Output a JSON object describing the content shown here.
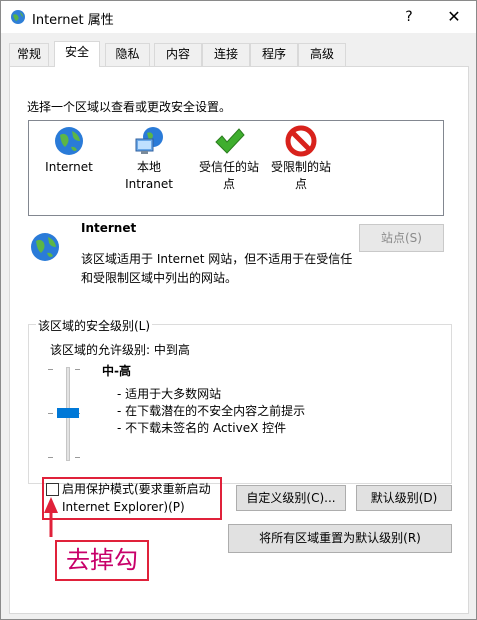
{
  "window": {
    "title": "Internet 属性",
    "help_label": "?",
    "close_label": "✕"
  },
  "tabs": [
    "常规",
    "安全",
    "隐私",
    "内容",
    "连接",
    "程序",
    "高级"
  ],
  "active_tab": "安全",
  "security": {
    "prompt": "选择一个区域以查看或更改安全设置。",
    "zones": [
      {
        "label_line1": "Internet",
        "label_line2": "",
        "icon": "globe-icon"
      },
      {
        "label_line1": "本地",
        "label_line2": "Intranet",
        "icon": "local-intranet-icon"
      },
      {
        "label_line1": "受信任的站",
        "label_line2": "点",
        "icon": "check-icon"
      },
      {
        "label_line1": "受限制的站",
        "label_line2": "点",
        "icon": "forbidden-icon"
      }
    ],
    "selected_zone": {
      "name": "Internet",
      "description": "该区域适用于 Internet 网站，但不适用于在受信任和受限制区域中列出的网站。"
    },
    "sites_button": "站点(S)"
  },
  "level": {
    "legend": "该区域的安全级别(L)",
    "allowed": "该区域的允许级别: 中到高",
    "name": "中-高",
    "points": [
      "- 适用于大多数网站",
      "- 在下载潜在的不安全内容之前提示",
      "- 不下载未签名的 ActiveX 控件"
    ],
    "slider_level_fraction": 0.5
  },
  "protected_mode": {
    "label_line1": "启用保护模式(要求重新启动",
    "label_line2": "Internet Explorer)(P)",
    "checked": false
  },
  "buttons": {
    "custom": "自定义级别(C)...",
    "default": "默认级别(D)",
    "reset": "将所有区域重置为默认级别(R)"
  },
  "annotation": {
    "text": "去掉勾",
    "color": "#e0213a"
  }
}
